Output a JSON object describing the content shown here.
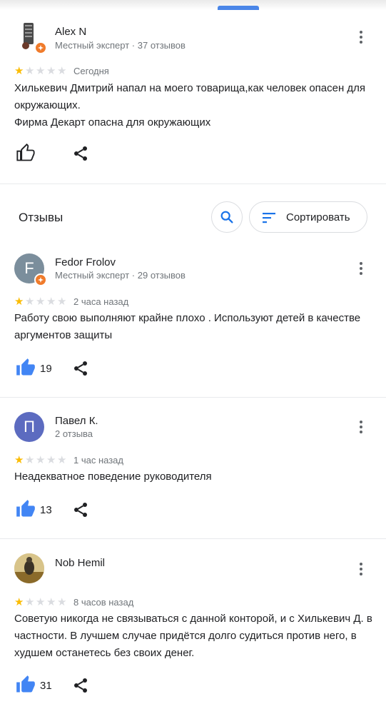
{
  "section": {
    "title": "Отзывы",
    "sort_label": "Сортировать"
  },
  "colors": {
    "accent_blue": "#4285f4",
    "star_on": "#fbbc04",
    "star_off": "#dadce0",
    "badge_orange": "#f07b2b"
  },
  "reviews": [
    {
      "author": "Alex N",
      "meta": "Местный эксперт · 37 отзывов",
      "rating": 1,
      "rating_max": 5,
      "time": "Сегодня",
      "text": [
        "Хилькевич Дмитрий напал на моего товарища,как человек опасен для окружающих.",
        "Фирма Декарт опасна для окружающих"
      ],
      "likes": "",
      "avatar_type": "photo"
    },
    {
      "author": "Fedor Frolov",
      "meta": "Местный эксперт · 29 отзывов",
      "rating": 1,
      "rating_max": 5,
      "time": "2 часа назад",
      "text": [
        "Работу свою выполняют крайне плохо . Используют детей в качестве аргументов защиты"
      ],
      "likes": "19",
      "avatar_letter": "F",
      "avatar_color": "#7b8e9c"
    },
    {
      "author": "Павел К.",
      "meta": "2 отзыва",
      "rating": 1,
      "rating_max": 5,
      "time": "1 час назад",
      "text": [
        "Неадекватное поведение руководителя"
      ],
      "likes": "13",
      "avatar_letter": "П",
      "avatar_color": "#5c6bc0"
    },
    {
      "author": "Nob Hemil",
      "meta": "",
      "rating": 1,
      "rating_max": 5,
      "time": "8 часов назад",
      "text": [
        "Советую никогда не связываться с данной конторой, и с Хилькевич Д. в частности. В лучшем случае придётся долго судиться против него, в худшем останетесь без своих денег."
      ],
      "likes": "31",
      "avatar_type": "photo"
    }
  ]
}
